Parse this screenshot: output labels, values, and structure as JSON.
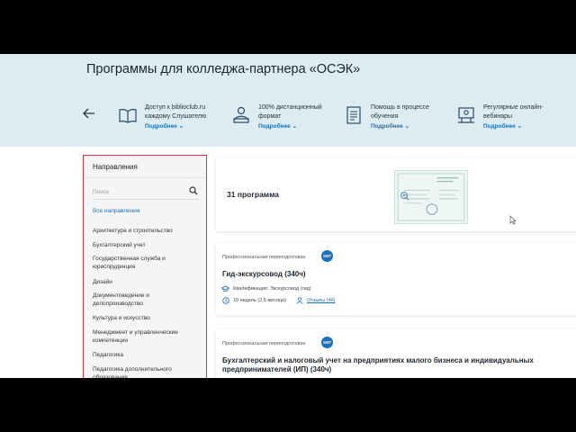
{
  "hero": {
    "title": "Программы для колледжа-партнера «ОСЭК»",
    "features": [
      {
        "icon": "book-icon",
        "line1": "Доступ к biblioclub.ru",
        "line2": "каждому Слушателю",
        "more": "Подробнее ⌄"
      },
      {
        "icon": "laptop-user-icon",
        "line1": "100% дистанционный",
        "line2": "формат",
        "more": "Подробнее ⌄"
      },
      {
        "icon": "document-list-icon",
        "line1": "Помощь в процессе",
        "line2": "обучения",
        "more": "Подробнее ⌄"
      },
      {
        "icon": "webinar-icon",
        "line1": "Регулярные онлайн-",
        "line2": "вебинары",
        "more": "Подробнее ⌄"
      }
    ]
  },
  "sidebar": {
    "title": "Направления",
    "search_placeholder": "Поиск",
    "all_label": "Все направления",
    "items": [
      "Архитектура и строительство",
      "Бухгалтерский учет",
      "Государственная служба и юриспруденция",
      "Дизайн",
      "Документоведение и делопроизводство",
      "Культура и искусство",
      "Менеджмент и управленческие компетенции",
      "Педагогика",
      "Педагогика дополнительного образования"
    ]
  },
  "results": {
    "count_label": "31 программа"
  },
  "programs": [
    {
      "type": "Профессиональная переподготовка",
      "badge": "ХИТ",
      "title": "Гид-экскурсовод (340ч)",
      "qualification": "Квалификация: Экскурсовод (гид)",
      "duration": "10 недель (2,5 месяца)",
      "reviews": "Отзывы (46)"
    },
    {
      "type": "Профессиональная переподготовка",
      "badge": "ХИТ",
      "title": "Бухгалтерский и налоговый учет на предприятиях малого бизнеса и индивидуальных предпринимателей (ИП) (340ч)"
    }
  ],
  "colors": {
    "hero_bg": "#dcecf1",
    "accent": "#1f6fb5",
    "sidebar_border": "#d0343f",
    "badge": "#1a73b8"
  }
}
